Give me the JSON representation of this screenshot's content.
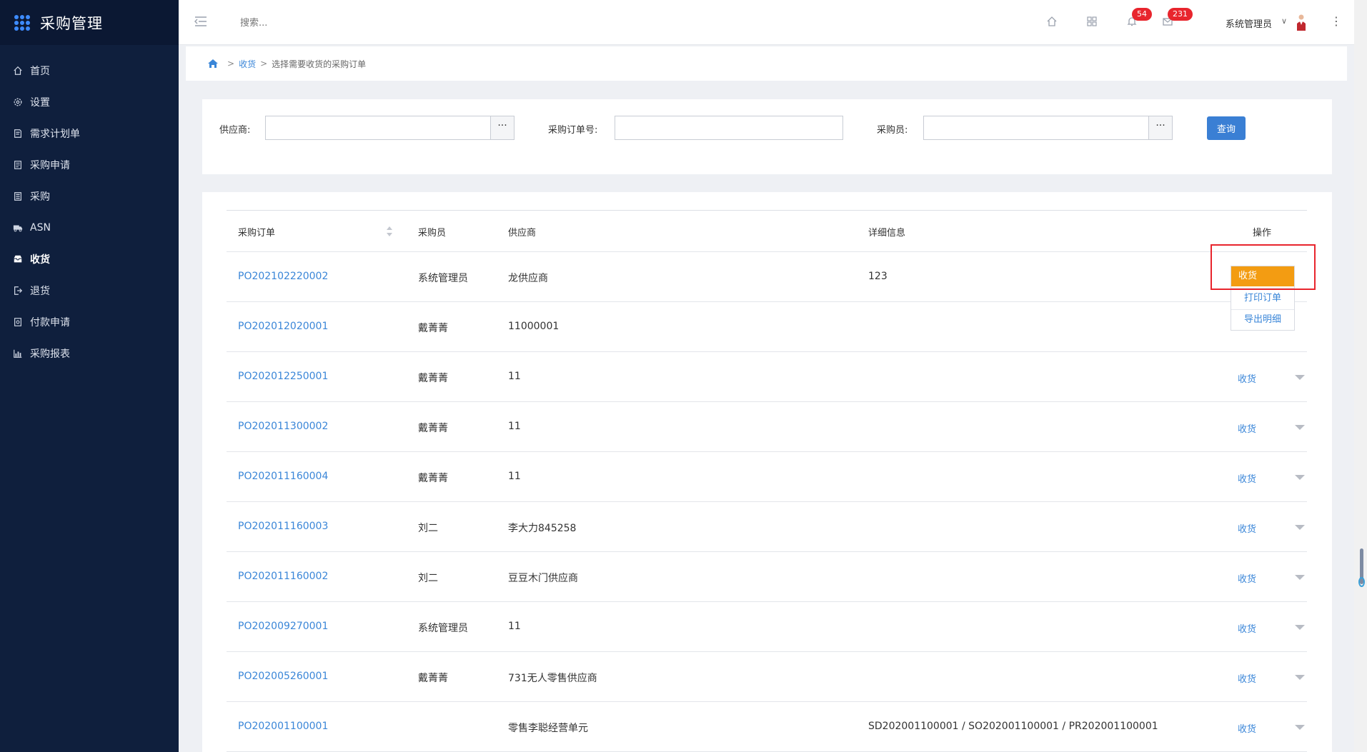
{
  "app": {
    "title": "采购管理"
  },
  "sidebar": {
    "items": [
      {
        "label": "首页",
        "icon": "home-icon"
      },
      {
        "label": "设置",
        "icon": "gear-icon"
      },
      {
        "label": "需求计划单",
        "icon": "document-icon"
      },
      {
        "label": "采购申请",
        "icon": "form-icon"
      },
      {
        "label": "采购",
        "icon": "list-icon"
      },
      {
        "label": "ASN",
        "icon": "truck-icon"
      },
      {
        "label": "收货",
        "icon": "inbox-icon"
      },
      {
        "label": "退货",
        "icon": "exit-icon"
      },
      {
        "label": "付款申请",
        "icon": "payment-icon"
      },
      {
        "label": "采购报表",
        "icon": "bar-chart-icon"
      }
    ],
    "active_index": 6
  },
  "topbar": {
    "search_placeholder": "搜索...",
    "notifications_count": "54",
    "messages_count": "231",
    "user_name": "系统管理员"
  },
  "breadcrumb": {
    "link": "收货",
    "current": "选择需要收货的采购订单",
    "separator": ">"
  },
  "filter": {
    "supplier_label": "供应商:",
    "po_label": "采购订单号:",
    "buyer_label": "采购员:",
    "ellipsis": "···",
    "query_button": "查询"
  },
  "table": {
    "headers": {
      "po": "采购订单",
      "buyer": "采购员",
      "supplier": "供应商",
      "details": "详细信息",
      "action": "操作"
    },
    "action_label": "收货",
    "rows": [
      {
        "po": "PO202102220002",
        "buyer": "系统管理员",
        "supplier": "龙供应商",
        "details": "123"
      },
      {
        "po": "PO202012020001",
        "buyer": "戴菁菁",
        "supplier": "11000001",
        "details": ""
      },
      {
        "po": "PO202012250001",
        "buyer": "戴菁菁",
        "supplier": "11",
        "details": ""
      },
      {
        "po": "PO202011300002",
        "buyer": "戴菁菁",
        "supplier": "11",
        "details": ""
      },
      {
        "po": "PO202011160004",
        "buyer": "戴菁菁",
        "supplier": "11",
        "details": ""
      },
      {
        "po": "PO202011160003",
        "buyer": "刘二",
        "supplier": "李大力845258",
        "details": ""
      },
      {
        "po": "PO202011160002",
        "buyer": "刘二",
        "supplier": "豆豆木门供应商",
        "details": ""
      },
      {
        "po": "PO202009270001",
        "buyer": "系统管理员",
        "supplier": "11",
        "details": ""
      },
      {
        "po": "PO202005260001",
        "buyer": "戴菁菁",
        "supplier": "731无人零售供应商",
        "details": ""
      },
      {
        "po": "PO202001100001",
        "buyer": "",
        "supplier": "零售李聪经营单元",
        "details": "SD202001100001 / SO202001100001 / PR202001100001"
      }
    ]
  },
  "popup": {
    "primary": "收货",
    "options": [
      "打印订单",
      "导出明细"
    ]
  },
  "colors": {
    "sidebar_bg": "#0f1f3d",
    "link": "#3a86d8",
    "primary_button": "#3a7fd4",
    "orange": "#f39c12",
    "badge": "#e8252d"
  }
}
